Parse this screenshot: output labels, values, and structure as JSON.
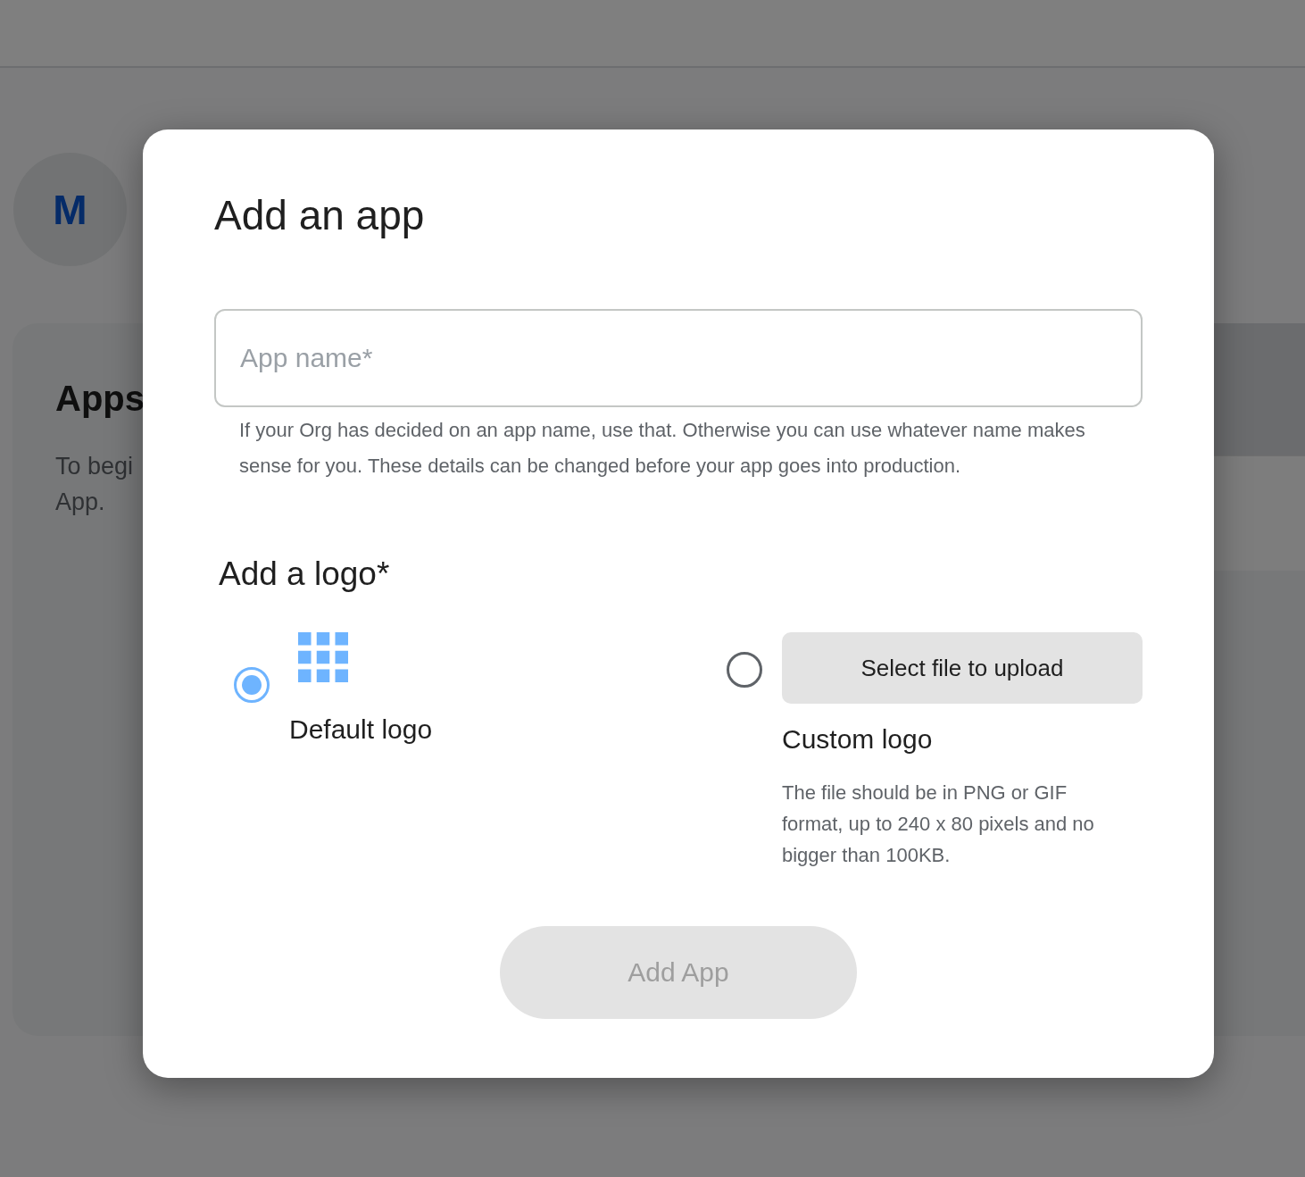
{
  "avatar": {
    "initial": "M"
  },
  "apps_card": {
    "title": "Apps",
    "description_lines": [
      "To begi",
      "App."
    ]
  },
  "dialog": {
    "title": "Add an app",
    "app_name_field": {
      "placeholder": "App name*"
    },
    "helper_text": "If your Org has decided on an app name, use that. Otherwise you can use whatever name makes sense for you. These details can be changed before your app goes into production.",
    "logo_section": {
      "title": "Add a logo*",
      "options": [
        {
          "kind": "default",
          "label": "Default logo",
          "selected": true
        },
        {
          "kind": "custom",
          "label": "Custom logo",
          "selected": false,
          "button": "Select file to upload",
          "description": "The file should be in PNG or GIF format, up to 240 x 80 pixels and no bigger than 100KB."
        }
      ]
    },
    "submit_button": {
      "label": "Add App",
      "disabled": true
    }
  }
}
